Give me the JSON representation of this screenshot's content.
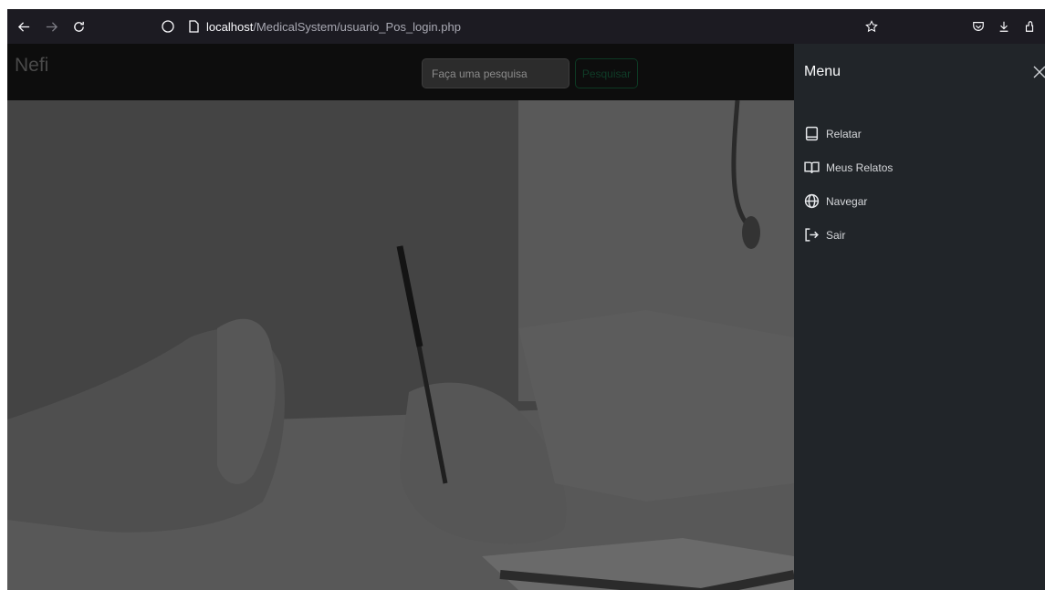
{
  "browser": {
    "url_host": "localhost",
    "url_path": "/MedicalSystem/usuario_Pos_login.php"
  },
  "navbar": {
    "brand": "Nefi",
    "search_placeholder": "Faça uma pesquisa",
    "search_button": "Pesquisar"
  },
  "offcanvas": {
    "title": "Menu",
    "items": [
      {
        "label": "Relatar",
        "icon": "tablet-icon"
      },
      {
        "label": "Meus Relatos",
        "icon": "book-icon"
      },
      {
        "label": "Navegar",
        "icon": "globe-icon"
      },
      {
        "label": "Sair",
        "icon": "logout-icon"
      }
    ]
  },
  "colors": {
    "browser_chrome": "#1c1b22",
    "navbar_bg": "#0d0d0d",
    "offcanvas_bg": "#212529",
    "search_button_border": "#0d3a24"
  }
}
